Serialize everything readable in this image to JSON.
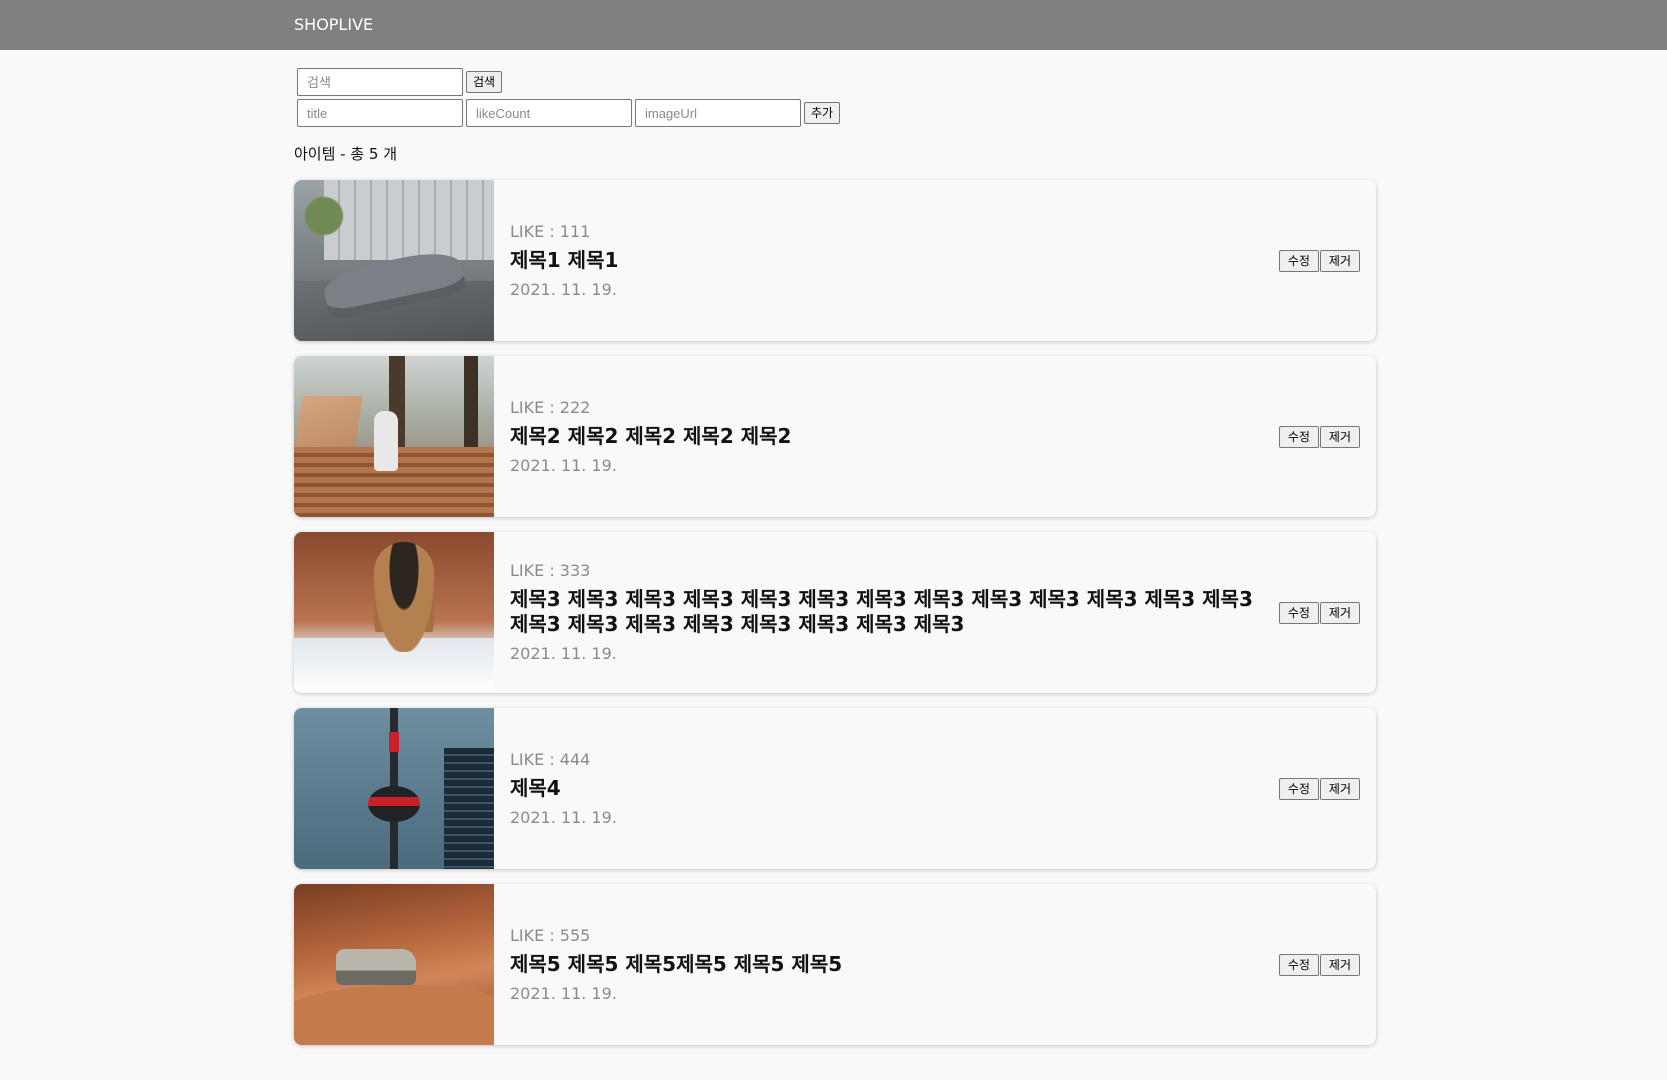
{
  "header": {
    "brand": "SHOPLIVE",
    "bg_color": "#808080"
  },
  "search": {
    "placeholder": "검색",
    "button_label": "검색"
  },
  "add_form": {
    "title_placeholder": "title",
    "likecount_placeholder": "likeCount",
    "imageurl_placeholder": "imageUrl",
    "button_label": "추가"
  },
  "count_text": "아이템 - 총 5 개",
  "items": [
    {
      "like": "LIKE : 111",
      "title": "제목1 제목1",
      "date": "2021. 11. 19.",
      "image": "car-photo",
      "edit_label": "수정",
      "remove_label": "제거"
    },
    {
      "like": "LIKE : 222",
      "title": "제목2 제목2 제목2 제목2 제목2",
      "date": "2021. 11. 19.",
      "image": "bike-photo",
      "edit_label": "수정",
      "remove_label": "제거"
    },
    {
      "like": "LIKE : 333",
      "title": "제목3 제목3 제목3 제목3 제목3 제목3 제목3 제목3 제목3 제목3 제목3 제목3 제목3 제목3 제목3 제목3 제목3 제목3 제목3 제목3 제목3",
      "date": "2021. 11. 19.",
      "image": "dog-photo",
      "edit_label": "수정",
      "remove_label": "제거"
    },
    {
      "like": "LIKE : 444",
      "title": "제목4",
      "date": "2021. 11. 19.",
      "image": "tower-photo",
      "edit_label": "수정",
      "remove_label": "제거"
    },
    {
      "like": "LIKE : 555",
      "title": "제목5 제목5 제목5제목5 제목5 제목5",
      "date": "2021. 11. 19.",
      "image": "desert-car-photo",
      "edit_label": "수정",
      "remove_label": "제거"
    }
  ]
}
